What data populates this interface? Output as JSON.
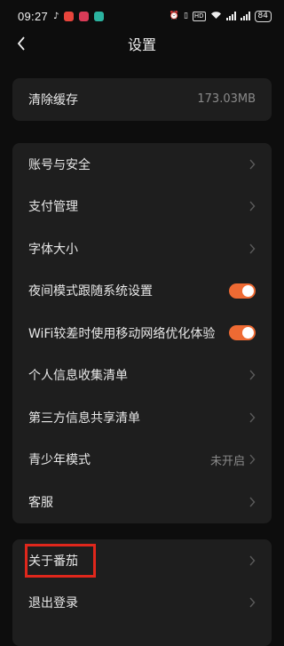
{
  "status_bar": {
    "time": "09:27",
    "battery": "84",
    "hd_label": "HD",
    "app_icons": [
      "tiktok-icon",
      "app-icon-red",
      "app-icon-red2",
      "app-icon-teal"
    ]
  },
  "nav": {
    "title": "设置"
  },
  "cache": {
    "label": "清除缓存",
    "value": "173.03MB"
  },
  "settings_items": [
    {
      "label": "账号与安全",
      "control": "chevron"
    },
    {
      "label": "支付管理",
      "control": "chevron"
    },
    {
      "label": "字体大小",
      "control": "chevron"
    },
    {
      "label": "夜间模式跟随系统设置",
      "control": "toggle",
      "on": true
    },
    {
      "label": "WiFi较差时使用移动网络优化体验",
      "control": "toggle",
      "on": true
    },
    {
      "label": "个人信息收集清单",
      "control": "chevron"
    },
    {
      "label": "第三方信息共享清单",
      "control": "chevron"
    },
    {
      "label": "青少年模式",
      "control": "chevron",
      "value": "未开启"
    },
    {
      "label": "客服",
      "control": "chevron"
    }
  ],
  "account_items": [
    {
      "label": "关于番茄",
      "control": "chevron"
    },
    {
      "label": "退出登录",
      "control": "chevron"
    }
  ],
  "colors": {
    "accent": "#ee6a33",
    "card": "#1e1e1e",
    "background": "#0d0d0d",
    "highlight": "#e0271c"
  }
}
